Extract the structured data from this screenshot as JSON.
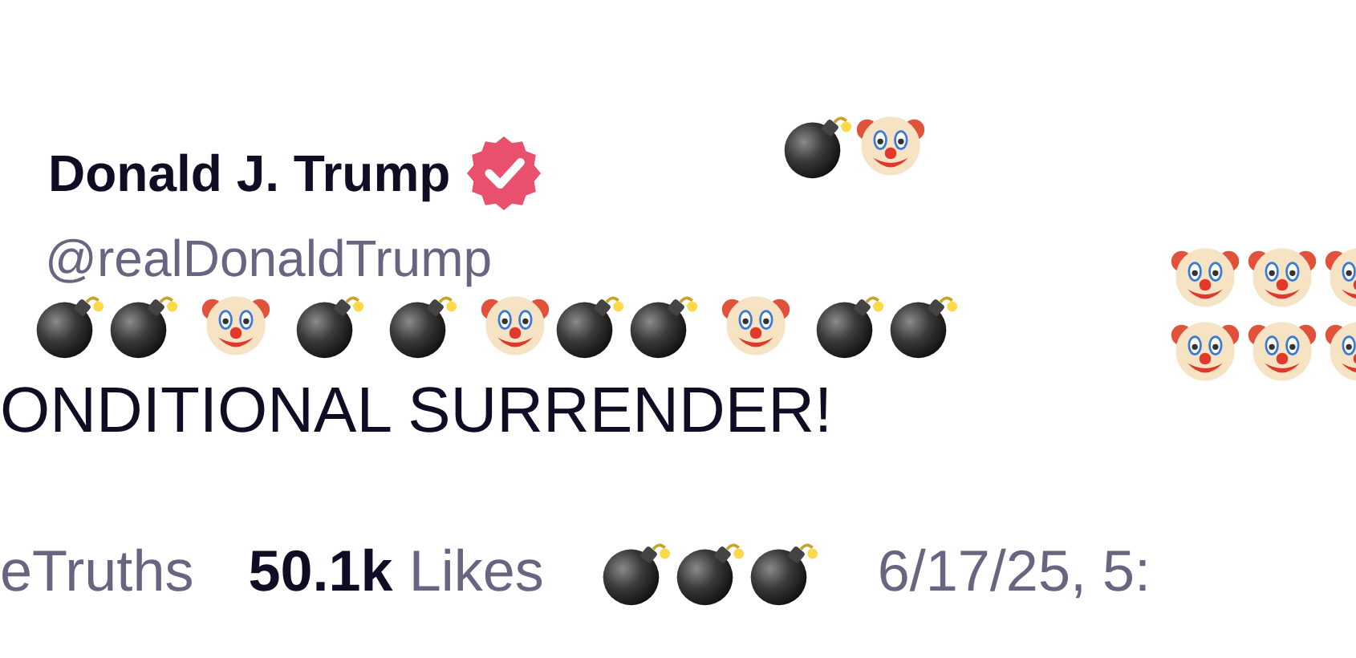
{
  "author": {
    "name": "Donald J. Trump",
    "verified": true,
    "handle": "@realDonaldTrump"
  },
  "sticker_line": [
    [
      {
        "kind": "bomb"
      },
      {
        "kind": "bomb"
      }
    ],
    [
      {
        "kind": "clown"
      }
    ],
    [
      {
        "kind": "bomb"
      }
    ],
    [
      {
        "kind": "bomb"
      }
    ],
    [
      {
        "kind": "clown"
      },
      {
        "kind": "bomb"
      },
      {
        "kind": "bomb"
      }
    ],
    [
      {
        "kind": "clown"
      }
    ],
    [
      {
        "kind": "bomb"
      },
      {
        "kind": "bomb"
      }
    ]
  ],
  "top_stickers": [
    {
      "kind": "bomb"
    },
    {
      "kind": "clown"
    }
  ],
  "side_stickers": [
    [
      {
        "kind": "clown"
      },
      {
        "kind": "clown"
      },
      {
        "kind": "clown"
      }
    ],
    [
      {
        "kind": "clown"
      },
      {
        "kind": "clown"
      },
      {
        "kind": "clown"
      }
    ]
  ],
  "body": "ONDITIONAL SURRENDER!",
  "stats": [
    {
      "kind": "plain",
      "text": "eTruths"
    },
    {
      "kind": "count",
      "value": "50.1k",
      "label": "Likes"
    },
    {
      "kind": "stickers",
      "items": [
        {
          "kind": "bomb"
        },
        {
          "kind": "bomb"
        },
        {
          "kind": "bomb"
        }
      ]
    },
    {
      "kind": "plain",
      "text": "6/17/25, 5:"
    }
  ]
}
